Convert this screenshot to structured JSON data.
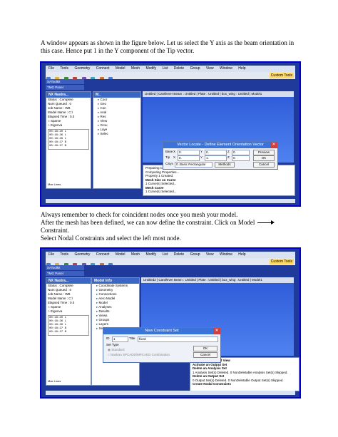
{
  "document": {
    "para1": "A window appears as shown in the figure below. Let us select the Y axis as the beam orientation in this case.  Hence put 1 in the Y component of the Tip vector.",
    "para2_line1": "Always remember to check for coincident nodes once you mesh your model.",
    "para2_line2": "After the mesh has been defined, we can  now define the constraint. Click on Model",
    "para2_line3": "Constraint.",
    "para2_line4": "Select Nodal Constraints and select the left most  node."
  },
  "app": {
    "menus": [
      "File",
      "Tools",
      "Geometry",
      "Connect",
      "Model",
      "Mesh",
      "Modify",
      "List",
      "Delete",
      "Group",
      "View",
      "Window",
      "Help"
    ],
    "custom_tools": "Custom Tools",
    "sidebar_tabs": [
      "SAToolkit",
      "TMG Panel"
    ],
    "nx_panel_title": "NX Nastra...",
    "nx_rows": [
      "Status : Complete",
      "Num Queued : 0",
      "Job Name : WB",
      "Model Name : C:\\",
      "Elapsed Time : 0.0",
      "Sparse",
      "Eigenva"
    ],
    "nx_log": [
      "00:18:20  L",
      "00:18:26  L",
      "00:18:26  L",
      "00:18:27  B",
      "00:18:27  B"
    ],
    "max_lines": "Max Lines"
  },
  "shot1": {
    "model_panel_title": "M..",
    "tree": [
      "Coor",
      "Geo",
      "Con",
      "Anal",
      "Res",
      "View",
      "Grou",
      "Laye",
      "Selec"
    ],
    "view_tabs": "Untitled | Cantilever Beam : Untitled | Plate : Untitled | box_wing : Untitled | Model1",
    "messages": [
      "Preparing Cross Section...",
      "Computing Properties...",
      "Property 1 Created.",
      "Mesh Size on Curve",
      "1 Curve(s) Selected...",
      "Mesh Curve",
      "1 Curve(s) Selected..."
    ],
    "dialog_title": "Vector Locate - Define Element Orientation Vector",
    "base_label": "Base",
    "tip_label": "Tip",
    "x_label": "X",
    "y_label": "Y",
    "z_label": "Z",
    "base_x": "0.",
    "base_y": "0.",
    "base_z": "0.",
    "tip_x": "0.",
    "tip_y": "1.",
    "tip_z": "0.",
    "csys_label": "CSys",
    "csys_value": "0..Basic Rectangular",
    "methods": "Methods",
    "preview": "Preview",
    "ok": "OK",
    "cancel": "Cancel"
  },
  "shot2": {
    "model_panel_title": "Model Info",
    "tree": [
      "Coordinate Systems",
      "Geometry",
      "Connections",
      "Aero Model",
      "Model",
      "Analyses",
      "Results",
      "Views",
      "Groups",
      "Layers",
      "Selection"
    ],
    "view_tabs": "Untitled2 | Cantilever Beam : Untitled | Plate : Untitled | box_wing : Untitled | Model1",
    "messages": [
      "Select an Animated View",
      "Activate an Output Set",
      "Delete an Analysis Set",
      "1 Analysis Set(s) Deleted. 0 NonDeletable Analysis Set(s) Skipped.",
      "Delete an Output Set",
      "0 Output Set(s) Deleted. 0 NonDeletable Output Set(s) Skipped.",
      "Create Nodal Constraints"
    ],
    "dialog_title": "New Constraint Set",
    "id_label": "ID",
    "id_value": "1",
    "title_label": "Title",
    "title_value": "fixed",
    "set_type": "Set Type",
    "standard": "Standard",
    "nastran_opt": "Nastran SPCADD/MPCADD Combination",
    "ok": "OK",
    "cancel": "Cancel"
  },
  "colors": {
    "screenshot_border": "#0000cc",
    "titlebar_blue": "#3b74d8",
    "viewport_blue": "#2d5ad8"
  }
}
